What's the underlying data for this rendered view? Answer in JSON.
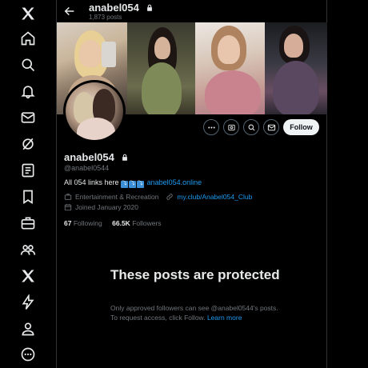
{
  "nav": {
    "items": [
      {
        "name": "x-logo-icon"
      },
      {
        "name": "home-icon"
      },
      {
        "name": "search-icon"
      },
      {
        "name": "notifications-icon"
      },
      {
        "name": "messages-icon"
      },
      {
        "name": "grok-icon"
      },
      {
        "name": "lists-icon"
      },
      {
        "name": "bookmarks-icon"
      },
      {
        "name": "jobs-icon"
      },
      {
        "name": "communities-icon"
      },
      {
        "name": "premium-x-icon"
      },
      {
        "name": "verified-orgs-icon"
      },
      {
        "name": "profile-icon"
      },
      {
        "name": "more-icon"
      }
    ]
  },
  "header": {
    "name": "anabel054",
    "post_count": "1,873 posts"
  },
  "profile": {
    "display_name": "anabel054",
    "handle": "@anabel0544",
    "bio_prefix": "All 054 links here",
    "bio_emojis": [
      "⤵",
      "⤵",
      "⤵"
    ],
    "bio_link": "anabel054.online",
    "category": "Entertainment & Recreation",
    "website": "my.club/Anabel054_Club",
    "joined": "Joined January 2020",
    "following_count": "67",
    "following_label": "Following",
    "followers_count": "66.5K",
    "followers_label": "Followers"
  },
  "actions": {
    "follow_label": "Follow"
  },
  "protected": {
    "title": "These posts are protected",
    "body": "Only approved followers can see @anabel0544's posts. To request access, click Follow.",
    "learn_more": "Learn more"
  },
  "colors": {
    "accent": "#1d9bf0",
    "background": "#000000",
    "text": "#e7e9ea",
    "muted": "#71767b"
  }
}
